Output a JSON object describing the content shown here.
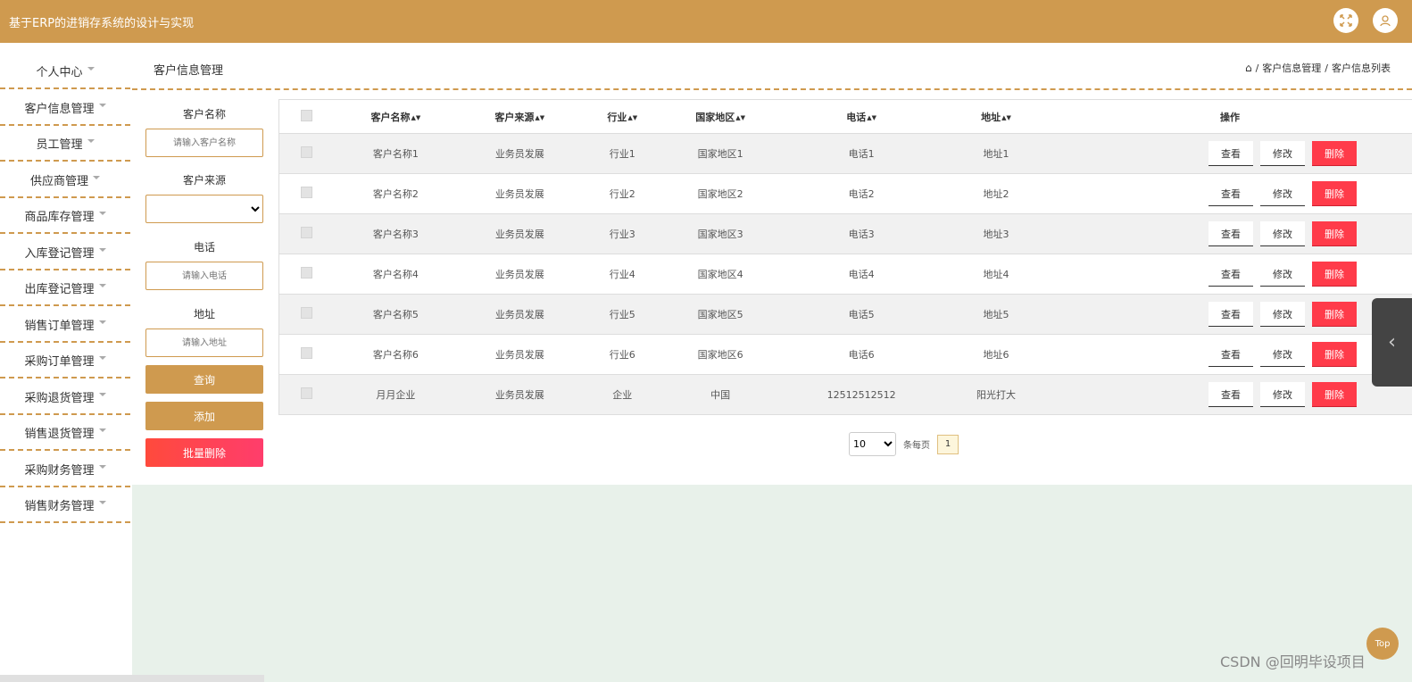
{
  "header": {
    "title": "基于ERP的进销存系统的设计与实现"
  },
  "sidebar": {
    "items": [
      {
        "label": "个人中心"
      },
      {
        "label": "客户信息管理"
      },
      {
        "label": "员工管理"
      },
      {
        "label": "供应商管理"
      },
      {
        "label": "商品库存管理"
      },
      {
        "label": "入库登记管理"
      },
      {
        "label": "出库登记管理"
      },
      {
        "label": "销售订单管理"
      },
      {
        "label": "采购订单管理"
      },
      {
        "label": "采购退货管理"
      },
      {
        "label": "销售退货管理"
      },
      {
        "label": "采购财务管理"
      },
      {
        "label": "销售财务管理"
      }
    ]
  },
  "page": {
    "title": "客户信息管理",
    "breadcrumb": [
      "客户信息管理",
      "客户信息列表"
    ]
  },
  "search": {
    "name_label": "客户名称",
    "name_placeholder": "请输入客户名称",
    "source_label": "客户来源",
    "phone_label": "电话",
    "phone_placeholder": "请输入电话",
    "address_label": "地址",
    "address_placeholder": "请输入地址",
    "query_button": "查询",
    "add_button": "添加",
    "batch_delete_button": "批量删除"
  },
  "table": {
    "columns": [
      "客户名称",
      "客户来源",
      "行业",
      "国家地区",
      "电话",
      "地址",
      "操作"
    ],
    "rows": [
      {
        "name": "客户名称1",
        "source": "业务员发展",
        "industry": "行业1",
        "region": "国家地区1",
        "phone": "电话1",
        "address": "地址1"
      },
      {
        "name": "客户名称2",
        "source": "业务员发展",
        "industry": "行业2",
        "region": "国家地区2",
        "phone": "电话2",
        "address": "地址2"
      },
      {
        "name": "客户名称3",
        "source": "业务员发展",
        "industry": "行业3",
        "region": "国家地区3",
        "phone": "电话3",
        "address": "地址3"
      },
      {
        "name": "客户名称4",
        "source": "业务员发展",
        "industry": "行业4",
        "region": "国家地区4",
        "phone": "电话4",
        "address": "地址4"
      },
      {
        "name": "客户名称5",
        "source": "业务员发展",
        "industry": "行业5",
        "region": "国家地区5",
        "phone": "电话5",
        "address": "地址5"
      },
      {
        "name": "客户名称6",
        "source": "业务员发展",
        "industry": "行业6",
        "region": "国家地区6",
        "phone": "电话6",
        "address": "地址6"
      },
      {
        "name": "月月企业",
        "source": "业务员发展",
        "industry": "企业",
        "region": "中国",
        "phone": "12512512512",
        "address": "阳光打大"
      }
    ],
    "view_label": "查看",
    "edit_label": "修改",
    "delete_label": "删除"
  },
  "pagination": {
    "page_size": "10",
    "per_page_label": "条每页",
    "current_page": "1"
  },
  "misc": {
    "top_label": "Top",
    "watermark": "CSDN @回明毕设项目"
  },
  "colors": {
    "accent": "#cf9a4f",
    "danger": "#ff3b4a",
    "background": "#e8f1ea"
  }
}
